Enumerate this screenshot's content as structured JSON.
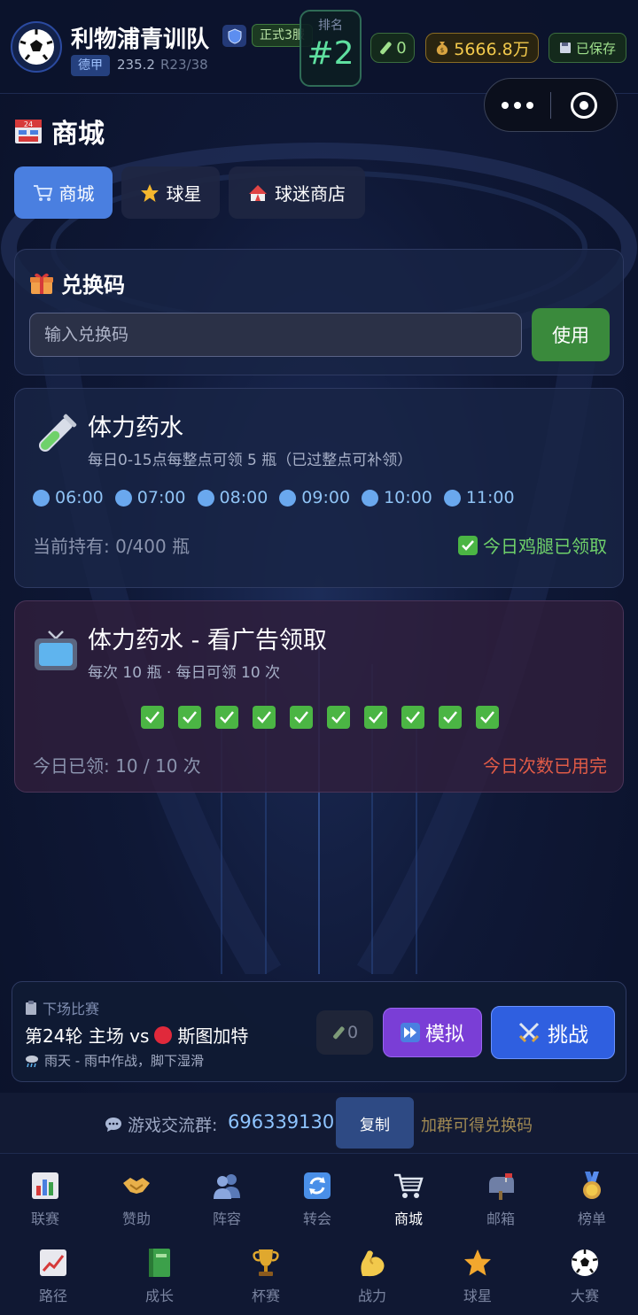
{
  "header": {
    "team_name": "利物浦青训队",
    "tier_badge": "正式3服",
    "league": "德甲",
    "rating": "235.2",
    "round": "R23/38",
    "rank_label": "排名",
    "rank_value": "#2",
    "potion_count": "0",
    "money": "5666.8万",
    "saved_label": "已保存"
  },
  "page": {
    "title": "商城"
  },
  "tabs": [
    {
      "label": "商城",
      "icon": "cart-icon",
      "active": true
    },
    {
      "label": "球星",
      "icon": "star-icon",
      "active": false
    },
    {
      "label": "球迷商店",
      "icon": "circus-tent-icon",
      "active": false
    }
  ],
  "redeem": {
    "title": "兑换码",
    "placeholder": "输入兑换码",
    "button": "使用"
  },
  "potion_daily": {
    "title": "体力药水",
    "description": "每日0-15点每整点可领 5 瓶（已过整点可补领）",
    "slots": [
      "06:00",
      "07:00",
      "08:00",
      "09:00",
      "10:00",
      "11:00"
    ],
    "holding": "当前持有: 0/400 瓶",
    "claimed_status": "今日鸡腿已领取"
  },
  "potion_ad": {
    "title": "体力药水 - 看广告领取",
    "description": "每次 10 瓶 · 每日可领 10 次",
    "claimed_checks": 10,
    "claimed_text": "今日已领: 10 / 10 次",
    "limit_text": "今日次数已用完"
  },
  "next_match": {
    "label": "下场比赛",
    "info_prefix": "第24轮 主场 vs",
    "opponent": "斯图加特",
    "weather": "雨天 - 雨中作战，脚下湿滑",
    "potion_count": "0",
    "simulate_label": "模拟",
    "challenge_label": "挑战"
  },
  "group": {
    "label": "游戏交流群:",
    "number": "696339130",
    "copy_label": "复制",
    "hint": "加群可得兑换码"
  },
  "nav": {
    "row1": [
      {
        "label": "联赛",
        "icon": "bar-chart-icon"
      },
      {
        "label": "赞助",
        "icon": "handshake-icon"
      },
      {
        "label": "阵容",
        "icon": "people-icon"
      },
      {
        "label": "转会",
        "icon": "refresh-icon"
      },
      {
        "label": "商城",
        "icon": "cart-icon",
        "active": true
      },
      {
        "label": "邮箱",
        "icon": "mailbox-icon"
      },
      {
        "label": "榜单",
        "icon": "medal-icon"
      }
    ],
    "row2": [
      {
        "label": "路径",
        "icon": "trend-chart-icon"
      },
      {
        "label": "成长",
        "icon": "book-icon"
      },
      {
        "label": "杯赛",
        "icon": "trophy-icon"
      },
      {
        "label": "战力",
        "icon": "flexed-bicep-icon"
      },
      {
        "label": "球星",
        "icon": "star-icon"
      },
      {
        "label": "大赛",
        "icon": "soccer-ball-icon"
      }
    ]
  },
  "colors": {
    "background": "#0f1836",
    "accent_tab": "#4a7fe0",
    "use_button": "#3a8a3c",
    "simulate_button": "#7a3ed6",
    "challenge_button": "#2f5fe0",
    "success_green": "#6fd16a",
    "limit_red": "#e05b47"
  }
}
